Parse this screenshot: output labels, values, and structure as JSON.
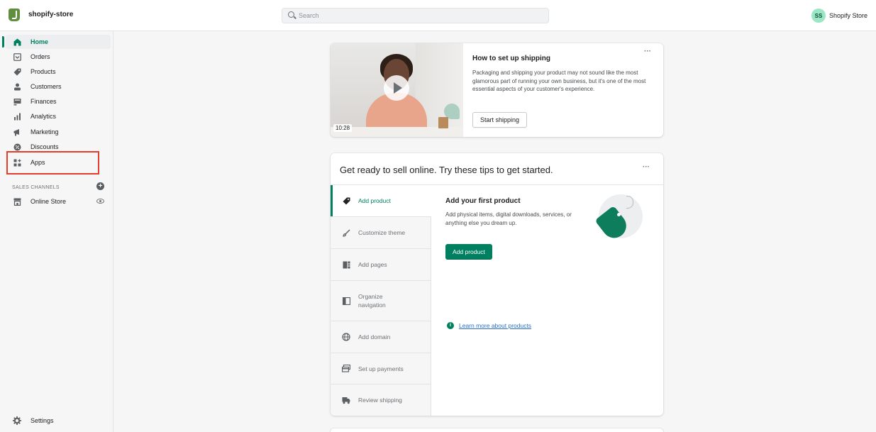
{
  "topbar": {
    "store_name": "shopify-store",
    "search_placeholder": "Search",
    "avatar_initials": "SS",
    "account_name": "Shopify Store"
  },
  "sidebar": {
    "items": [
      {
        "label": "Home",
        "icon": "home-icon",
        "active": true
      },
      {
        "label": "Orders",
        "icon": "orders-icon"
      },
      {
        "label": "Products",
        "icon": "products-icon"
      },
      {
        "label": "Customers",
        "icon": "customers-icon"
      },
      {
        "label": "Finances",
        "icon": "finances-icon"
      },
      {
        "label": "Analytics",
        "icon": "analytics-icon"
      },
      {
        "label": "Marketing",
        "icon": "marketing-icon"
      },
      {
        "label": "Discounts",
        "icon": "discounts-icon"
      },
      {
        "label": "Apps",
        "icon": "apps-icon",
        "highlighted": true
      }
    ],
    "sales_channels_label": "SALES CHANNELS",
    "online_store_label": "Online Store",
    "settings_label": "Settings"
  },
  "shipping_card": {
    "title": "How to set up shipping",
    "description": "Packaging and shipping your product may not sound like the most glamorous part of running your own business, but it's one of the most essential aspects of your customer's experience.",
    "button": "Start shipping",
    "video_duration": "10:28",
    "more": "···"
  },
  "tips_card": {
    "title": "Get ready to sell online. Try these tips to get started.",
    "more": "···",
    "tabs": [
      {
        "label": "Add product",
        "icon": "tag-icon",
        "active": true
      },
      {
        "label": "Customize theme",
        "icon": "brush-icon"
      },
      {
        "label": "Add pages",
        "icon": "pages-icon"
      },
      {
        "label": "Organize navigation",
        "icon": "navigation-icon"
      },
      {
        "label": "Add domain",
        "icon": "globe-icon"
      },
      {
        "label": "Set up payments",
        "icon": "payments-icon"
      },
      {
        "label": "Review shipping",
        "icon": "truck-icon"
      }
    ],
    "panel": {
      "title": "Add your first product",
      "description": "Add physical items, digital downloads, services, or anything else you dream up.",
      "button": "Add product",
      "link": "Learn more about products"
    }
  },
  "colors": {
    "brand_green": "#008060",
    "highlight_red": "#e53c2c",
    "link_blue": "#2c6ecb"
  }
}
